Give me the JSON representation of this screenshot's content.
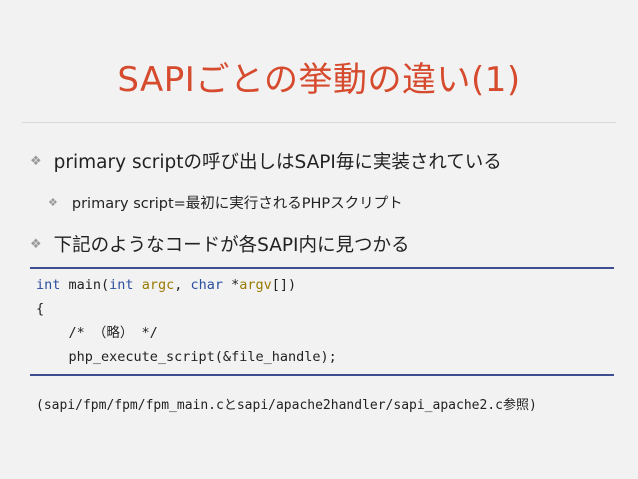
{
  "slide": {
    "title": "SAPIごとの挙動の違い(1)",
    "bullet_mark": "❖",
    "bullets": [
      {
        "text": "primary scriptの呼び出しはSAPI毎に実装されている"
      },
      {
        "text": "primary script=最初に実行されるPHPスクリプト"
      },
      {
        "text": "下記のようなコードが各SAPI内に見つかる"
      }
    ],
    "code": {
      "line1": {
        "int1": "int",
        "main": " main(",
        "int2": "int",
        "argc": " argc",
        "comma": ", ",
        "char": "char",
        "star": " *",
        "argv": "argv",
        "close": "[])"
      },
      "line2": "{",
      "line3": "    /* （略） */",
      "line4": "    php_execute_script(&file_handle);"
    },
    "footnote": "(sapi/fpm/fpm/fpm_main.cとsapi/apache2handler/sapi_apache2.c参照)"
  },
  "colors": {
    "title": "#d64a2e",
    "rule": "#3d4f91",
    "keyword": "#2c4fa0",
    "variable": "#9a7a00"
  }
}
